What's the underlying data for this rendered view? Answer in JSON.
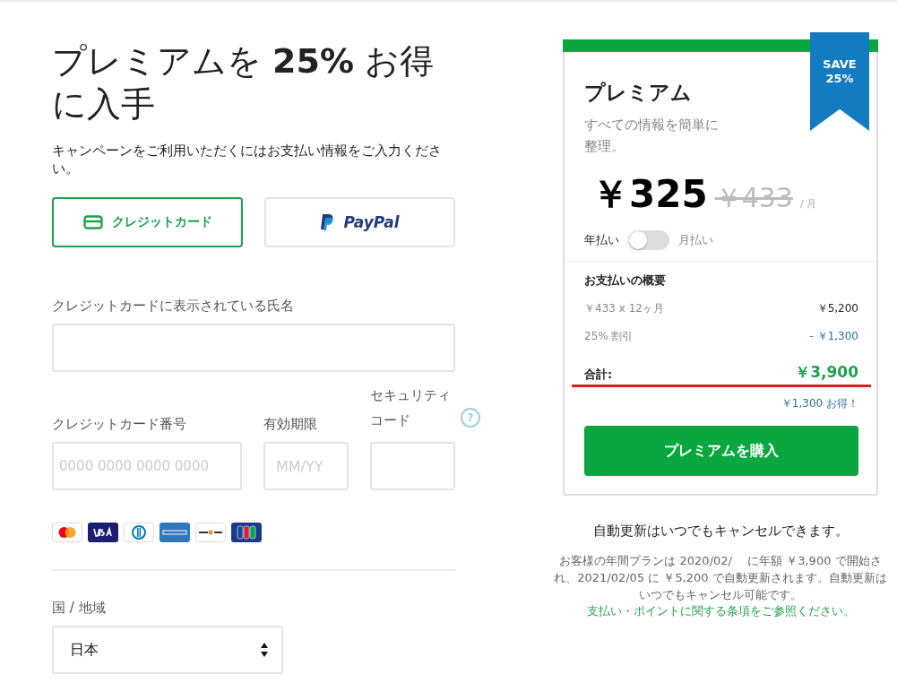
{
  "heading": "プレミアムを **25%** お得に入手",
  "subtitle": "キャンペーンをご利用いただくにはお支払い情報をご入力ください。",
  "payment_methods": [
    {
      "kind": "card",
      "label": "クレジットカード",
      "selected": true
    },
    {
      "kind": "paypal",
      "label": "PayPal",
      "selected": false
    }
  ],
  "name_field": {
    "label": "クレジットカードに表示されている氏名"
  },
  "card_number": {
    "label": "クレジットカード番号",
    "placeholder": "0000 0000 0000 0000"
  },
  "expiry": {
    "label": "有効期限",
    "placeholder": "MM/YY"
  },
  "security_code": {
    "label": "セキュリティコード",
    "help": "?"
  },
  "card_brands": [
    {
      "kind": "mastercard"
    },
    {
      "kind": "visa"
    },
    {
      "kind": "diners"
    },
    {
      "kind": "amex"
    },
    {
      "kind": "discover"
    },
    {
      "kind": "jcb"
    }
  ],
  "country": {
    "label": "国 / 地域",
    "value": "日本"
  },
  "plan": {
    "badge": [
      "SAVE",
      "25%"
    ],
    "name": "プレミアム",
    "description": "すべての情報を簡単に整理。",
    "price": "￥325",
    "old_price": "￥433",
    "per": "/ 月",
    "billing_toggle": {
      "left": "年払い",
      "right": "月払い",
      "on": false
    },
    "summary_title": "お支払いの概要",
    "lines": [
      {
        "label": "￥433 x 12ヶ月",
        "amount": "￥5,200",
        "kind": "charge"
      },
      {
        "label": "25% 割引",
        "amount": "- ￥1,300",
        "kind": "discount"
      }
    ],
    "total_label": "合計:",
    "total": "￥3,900",
    "savings": "￥1,300 お得！",
    "buy_button": "プレミアムを購入"
  },
  "cancel_note": "自動更新はいつでもキャンセルできます。",
  "renewal_text": "お客様の年間プランは 2020/02/　 に年額 ￥3,900 で開始され、2021/02/05 に ￥5,200 で自動更新されます。自動更新はいつでもキャンセル可能です。",
  "terms_link": "支払い・ポイントに関する条項をご参照ください。"
}
